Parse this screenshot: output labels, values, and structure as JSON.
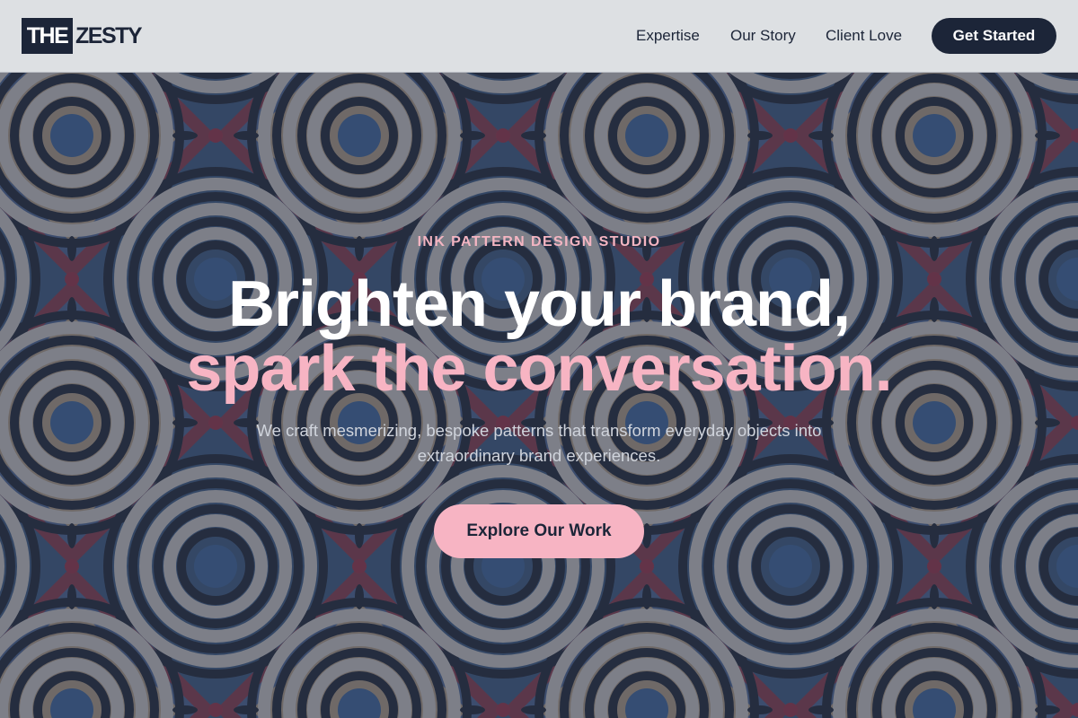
{
  "header": {
    "logo_box": "THE",
    "logo_text": "ZESTY",
    "nav": [
      "Expertise",
      "Our Story",
      "Client Love"
    ],
    "cta": "Get Started"
  },
  "hero": {
    "eyebrow": "INK PATTERN DESIGN STUDIO",
    "headline_line1": "Brighten your brand,",
    "headline_line2": "spark the conversation.",
    "subtext": "We craft mesmerizing, bespoke patterns that transform everyday objects into extraordinary brand experiences.",
    "cta": "Explore Our Work",
    "background_icon": "spiral-ink-pattern"
  },
  "colors": {
    "navy": "#1c2538",
    "pink": "#f7b4c3",
    "header_bg": "#dde0e3",
    "overlay": "#2c3447"
  }
}
